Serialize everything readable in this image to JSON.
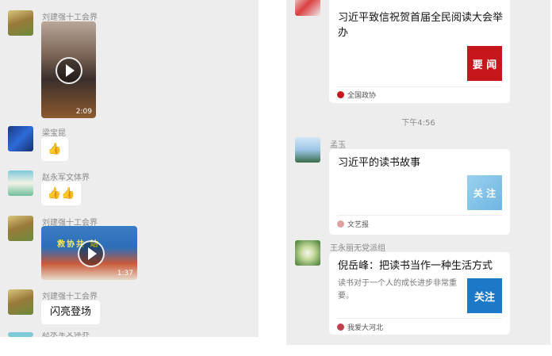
{
  "left_chat": {
    "messages": [
      {
        "sender": "刘建强十工会界",
        "type": "video",
        "duration": "2:09"
      },
      {
        "sender": "梁宝昆",
        "type": "emoji",
        "emoji": "👍"
      },
      {
        "sender": "赵永军文体界",
        "type": "emoji",
        "emoji": "👍👍"
      },
      {
        "sender": "刘建强十工会界",
        "type": "video",
        "duration": "1:37",
        "banner_text": "救协共 站"
      },
      {
        "sender": "刘建强十工会界",
        "type": "text",
        "text": "闪亮登场"
      }
    ],
    "cut_sender": "赵永军文体界"
  },
  "right_chat": {
    "card1": {
      "title": "习近平致信祝贺首届全民阅读大会举办",
      "thumb_text": "要 闻",
      "source": "全国政协"
    },
    "timestamp": "下午4:56",
    "card2": {
      "sender": "孟玉",
      "title": "习近平的读书故事",
      "thumb_text": "关 注",
      "source": "文艺报"
    },
    "card3": {
      "sender": "王永丽无党派组",
      "title": "倪岳峰：把读书当作一种生活方式",
      "desc": "读书对于一个人的成长进步非常重要。",
      "thumb_text": "关注",
      "source": "我爱大河北"
    }
  },
  "colors": {
    "chat_bg": "#ededed",
    "bubble": "#ffffff",
    "thumb_red": "#c8161d",
    "thumb_blue": "#1e78c8",
    "thumb_light_blue": "#8cc4e8"
  }
}
